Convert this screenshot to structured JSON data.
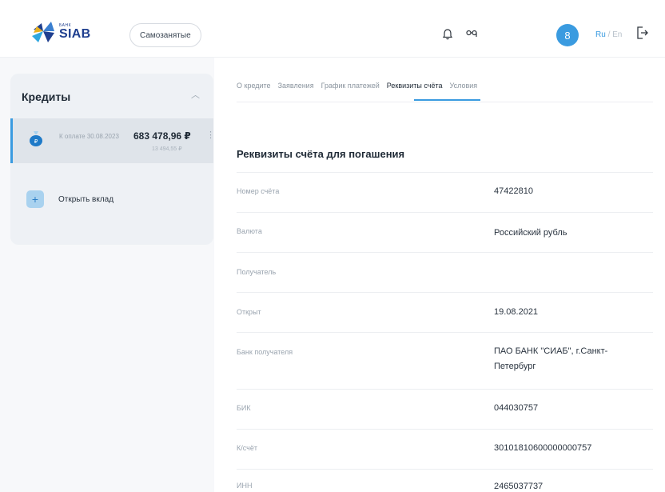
{
  "header": {
    "logo_small": "БАНК",
    "logo_text": "SIAB",
    "pill_label": "Самозанятые",
    "avatar_letter": "8",
    "lang_active": "Ru",
    "lang_sep": "/",
    "lang_other": "En",
    "icons": [
      "bell-icon",
      "glasses-icon",
      "logout-icon"
    ]
  },
  "sidebar": {
    "title": "Кредиты",
    "credit": {
      "label": "К оплате 30.08.2023",
      "amount": "683 478,96 ₽",
      "sub_amount": "13 494,55 ₽"
    },
    "open_deposit": "Открыть вклад"
  },
  "tabs": [
    {
      "label": "О кредите",
      "active": false
    },
    {
      "label": "Заявления",
      "active": false
    },
    {
      "label": "График платежей",
      "active": false
    },
    {
      "label": "Реквизиты счёта",
      "active": true
    },
    {
      "label": "Условия",
      "active": false
    }
  ],
  "details": {
    "title": "Реквизиты счёта для погашения",
    "rows": [
      {
        "label": "Номер счёта",
        "value": "47422810"
      },
      {
        "label": "Валюта",
        "value": "Российский рубль"
      },
      {
        "label": "Получатель",
        "value": ""
      },
      {
        "label": "Открыт",
        "value": "19.08.2021"
      },
      {
        "label": "Банк получателя",
        "value": "ПАО БАНК \"СИАБ\", г.Санкт-Петербург"
      },
      {
        "label": "БИК",
        "value": "044030757"
      },
      {
        "label": "К/счёт",
        "value": "30101810600000000757"
      },
      {
        "label": "ИНН",
        "value": "2465037737"
      }
    ]
  },
  "colors": {
    "accent": "#3a9be0",
    "brand": "#1f3f8f"
  }
}
